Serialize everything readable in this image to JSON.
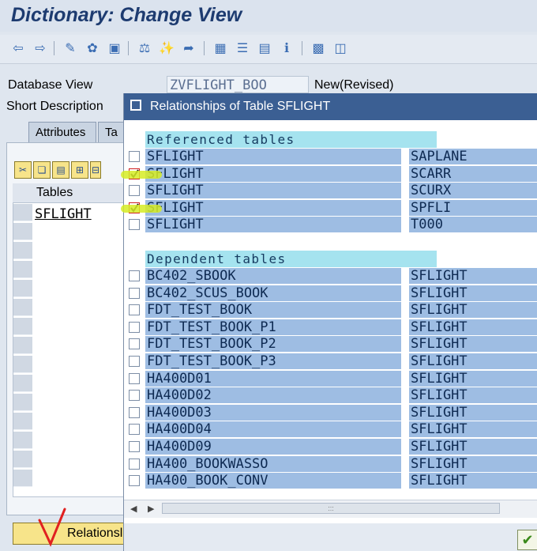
{
  "window": {
    "title": "Dictionary: Change View"
  },
  "toolbar": {
    "icons": [
      "back-arrow-icon",
      "forward-arrow-icon",
      "display-change-icon",
      "other-object-icon",
      "activate-icon",
      "check-icon",
      "where-used-icon",
      "navigate-icon",
      "hierarchy-icon",
      "align-icon",
      "list-icon",
      "info-icon",
      "graphic-icon",
      "columns-icon"
    ]
  },
  "header": {
    "database_view_label": "Database View",
    "database_view_value": "ZVFLIGHT_BOO",
    "status": "New(Revised)",
    "short_description_label": "Short Description"
  },
  "tabs": [
    "Attributes",
    "Ta"
  ],
  "left": {
    "tables_header": "Tables",
    "rows": [
      "SFLIGHT"
    ],
    "relationships_button": "Relationsl"
  },
  "dialog": {
    "title": "Relationships of Table SFLIGHT",
    "referenced_header": "Referenced tables",
    "referenced": [
      {
        "table": "SFLIGHT",
        "related": "SAPLANE",
        "checked": false
      },
      {
        "table": "SFLIGHT",
        "related": "SCARR",
        "checked": true
      },
      {
        "table": "SFLIGHT",
        "related": "SCURX",
        "checked": false
      },
      {
        "table": "SFLIGHT",
        "related": "SPFLI",
        "checked": true
      },
      {
        "table": "SFLIGHT",
        "related": "T000",
        "checked": false
      }
    ],
    "dependent_header": "Dependent tables",
    "dependent": [
      {
        "table": "BC402_SBOOK",
        "related": "SFLIGHT",
        "checked": false
      },
      {
        "table": "BC402_SCUS_BOOK",
        "related": "SFLIGHT",
        "checked": false
      },
      {
        "table": "FDT_TEST_BOOK",
        "related": "SFLIGHT",
        "checked": false
      },
      {
        "table": "FDT_TEST_BOOK_P1",
        "related": "SFLIGHT",
        "checked": false
      },
      {
        "table": "FDT_TEST_BOOK_P2",
        "related": "SFLIGHT",
        "checked": false
      },
      {
        "table": "FDT_TEST_BOOK_P3",
        "related": "SFLIGHT",
        "checked": false
      },
      {
        "table": "HA400D01",
        "related": "SFLIGHT",
        "checked": false
      },
      {
        "table": "HA400D02",
        "related": "SFLIGHT",
        "checked": false
      },
      {
        "table": "HA400D03",
        "related": "SFLIGHT",
        "checked": false
      },
      {
        "table": "HA400D04",
        "related": "SFLIGHT",
        "checked": false
      },
      {
        "table": "HA400D09",
        "related": "SFLIGHT",
        "checked": false
      },
      {
        "table": "HA400_BOOKWASSO",
        "related": "SFLIGHT",
        "checked": false
      },
      {
        "table": "HA400_BOOK_CONV",
        "related": "SFLIGHT",
        "checked": false
      }
    ]
  }
}
